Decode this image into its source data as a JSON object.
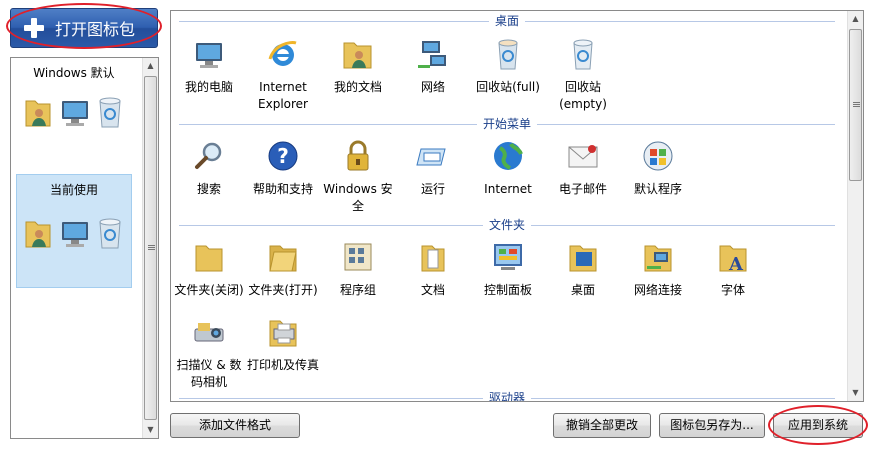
{
  "open_pack_button": {
    "label": "打开图标包"
  },
  "packs": [
    {
      "name": "Windows 默认",
      "selected": false
    },
    {
      "name": "当前使用",
      "selected": true
    }
  ],
  "sections": {
    "desktop": {
      "title": "桌面",
      "items": [
        "我的电脑",
        "Internet Explorer",
        "我的文档",
        "网络",
        "回收站(full)",
        "回收站 (empty)"
      ]
    },
    "start_menu": {
      "title": "开始菜单",
      "items": [
        "搜索",
        "帮助和支持",
        "Windows 安全",
        "运行",
        "Internet",
        "电子邮件",
        "默认程序"
      ]
    },
    "folders": {
      "title": "文件夹",
      "items": [
        "文件夹(关闭)",
        "文件夹(打开)",
        "程序组",
        "文档",
        "控制面板",
        "桌面",
        "网络连接",
        "字体",
        "扫描仪 & 数码相机",
        "打印机及传真"
      ]
    },
    "drives": {
      "title": "驱动器"
    }
  },
  "buttons": {
    "add_format": "添加文件格式",
    "revert_all": "撤销全部更改",
    "save_as": "图标包另存为...",
    "apply": "应用到系统"
  },
  "colors": {
    "annotation": "#e0202a",
    "selection": "#cce4f7",
    "section_title": "#1a3f8a"
  },
  "icons": {
    "pack_icons": [
      "user-folder-icon",
      "computer-icon",
      "recycle-bin-icon"
    ],
    "desktop": [
      "computer-icon",
      "internet-explorer-icon",
      "user-folder-icon",
      "network-icon",
      "recycle-bin-full-icon",
      "recycle-bin-empty-icon"
    ],
    "start_menu": [
      "search-magnifier-icon",
      "help-icon",
      "security-lock-icon",
      "run-icon",
      "globe-icon",
      "email-icon",
      "default-programs-icon"
    ],
    "folders": [
      "folder-closed-icon",
      "folder-open-icon",
      "program-group-icon",
      "documents-icon",
      "control-panel-icon",
      "desktop-folder-icon",
      "network-connections-icon",
      "fonts-folder-icon",
      "scanner-camera-icon",
      "printer-fax-icon"
    ]
  }
}
